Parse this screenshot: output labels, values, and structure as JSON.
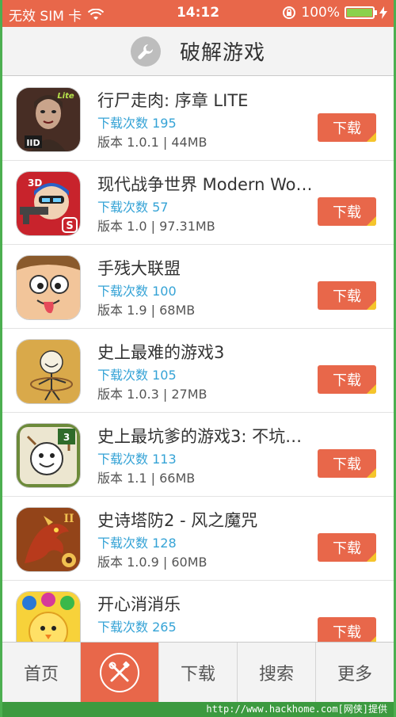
{
  "status_bar": {
    "carrier": "无效 SIM 卡",
    "time": "14:12",
    "battery": "100%",
    "battery_level": 1.0
  },
  "header": {
    "title": "破解游戏",
    "icon": "wrench-icon"
  },
  "apps": [
    {
      "name": "行尸走肉: 序章 LITE",
      "downloads": "下载次数 195",
      "version": "版本 1.0.1 | 44MB",
      "button": "下载"
    },
    {
      "name": "现代战争世界 Modern Wo…",
      "downloads": "下载次数 57",
      "version": "版本 1.0 | 97.31MB",
      "button": "下载"
    },
    {
      "name": "手残大联盟",
      "downloads": "下载次数 100",
      "version": "版本 1.9 | 68MB",
      "button": "下载"
    },
    {
      "name": "史上最难的游戏3",
      "downloads": "下载次数 105",
      "version": "版本 1.0.3 | 27MB",
      "button": "下载"
    },
    {
      "name": "史上最坑爹的游戏3: 不坑…",
      "downloads": "下载次数 113",
      "version": "版本 1.1 | 66MB",
      "button": "下载"
    },
    {
      "name": "史诗塔防2 - 风之魔咒",
      "downloads": "下载次数 128",
      "version": "版本 1.0.9 | 60MB",
      "button": "下载"
    },
    {
      "name": "开心消消乐",
      "downloads": "下载次数 265",
      "version": "",
      "button": "下载"
    }
  ],
  "tabs": [
    {
      "label": "首页"
    },
    {
      "label": "",
      "icon": "tools-icon"
    },
    {
      "label": "下载"
    },
    {
      "label": "搜索"
    },
    {
      "label": "更多"
    }
  ],
  "footer": "http://www.hackhome.com[网侠]提供",
  "colors": {
    "accent": "#e8674a",
    "link": "#35a3d6",
    "frame": "#4caf50"
  }
}
